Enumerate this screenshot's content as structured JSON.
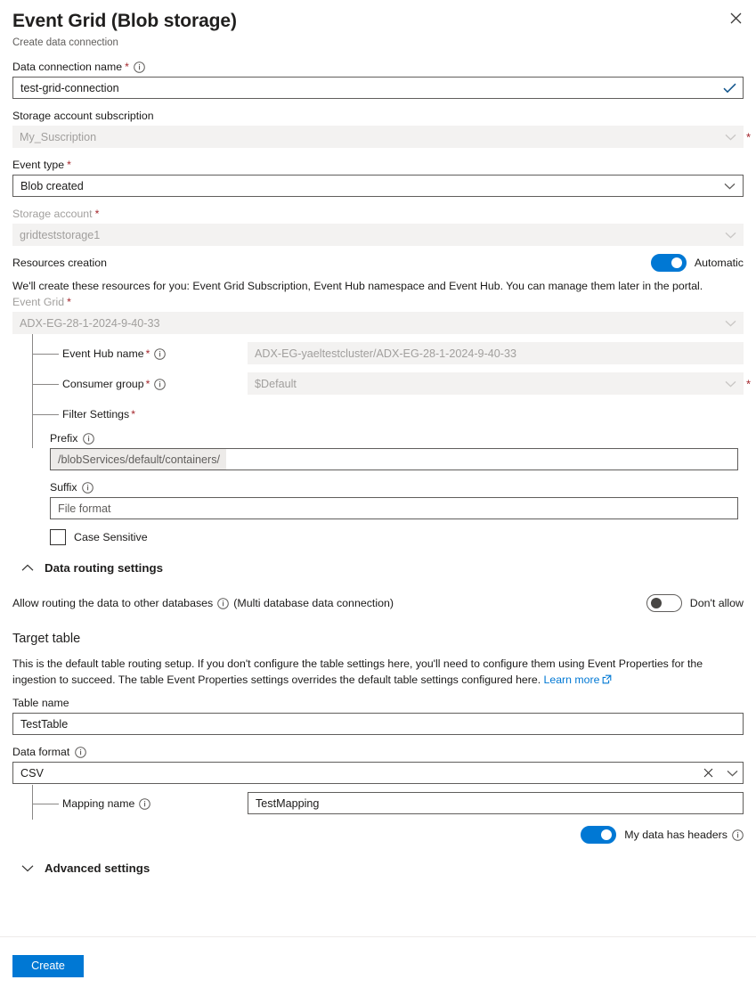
{
  "header": {
    "title": "Event Grid (Blob storage)",
    "subtitle": "Create data connection",
    "close_icon": "close-icon"
  },
  "colors": {
    "accent": "#0078d4",
    "required_asterisk": "#a4262c",
    "link": "#0078d4",
    "disabled_bg": "#f3f2f1",
    "disabled_text": "#a19f9d",
    "border": "#605e5c"
  },
  "form": {
    "data_connection_name": {
      "label": "Data connection name",
      "required": true,
      "info_icon": "info-icon",
      "value": "test-grid-connection",
      "validation_icon": "checkmark-icon"
    },
    "storage_account_subscription": {
      "label": "Storage account subscription",
      "required": false,
      "value": "My_Suscription",
      "disabled": true,
      "external_required_marker": "*",
      "chevron_icon": "chevron-down-icon"
    },
    "event_type": {
      "label": "Event type",
      "required": true,
      "value": "Blob created",
      "disabled": false,
      "chevron_icon": "chevron-down-icon"
    },
    "storage_account": {
      "label": "Storage account",
      "required": true,
      "value": "gridteststorage1",
      "disabled": true,
      "chevron_icon": "chevron-down-icon"
    },
    "resources_creation": {
      "label": "Resources creation",
      "toggle_state": "on",
      "toggle_label": "Automatic",
      "note": "We'll create these resources for you: Event Grid Subscription, Event Hub namespace and Event Hub. You can manage them later in the portal."
    },
    "event_grid": {
      "label": "Event Grid",
      "required": true,
      "value": "ADX-EG-28-1-2024-9-40-33",
      "disabled": true,
      "chevron_icon": "chevron-down-icon"
    },
    "event_hub_name": {
      "label": "Event Hub name",
      "required": true,
      "info_icon": "info-icon",
      "value": "ADX-EG-yaeltestcluster/ADX-EG-28-1-2024-9-40-33",
      "disabled": true
    },
    "consumer_group": {
      "label": "Consumer group",
      "required": true,
      "info_icon": "info-icon",
      "value": "$Default",
      "disabled": true,
      "external_required_marker": "*",
      "chevron_icon": "chevron-down-icon"
    },
    "filter_settings": {
      "label": "Filter Settings",
      "required": true,
      "prefix": {
        "label": "Prefix",
        "info_icon": "info-icon",
        "fixed_prefix": "/blobServices/default/containers/",
        "value": ""
      },
      "suffix": {
        "label": "Suffix",
        "info_icon": "info-icon",
        "placeholder": "File format",
        "value": ""
      },
      "case_sensitive": {
        "label": "Case Sensitive",
        "checked": false
      }
    }
  },
  "data_routing": {
    "section_title": "Data routing settings",
    "chevron_icon": "chevron-up-icon",
    "expanded": true,
    "allow_routing": {
      "label": "Allow routing the data to other databases",
      "info_icon": "info-icon",
      "suffix_text": "(Multi database data connection)",
      "toggle_state": "off",
      "toggle_label": "Don't allow"
    },
    "target_table": {
      "title": "Target table",
      "description_part1": "This is the default table routing setup. If you don't configure the table settings here, you'll need to configure them using Event Properties for the ingestion to succeed. The table Event Properties settings overrides the default table settings configured here. ",
      "learn_more": "Learn more",
      "learn_more_icon": "external-link-icon",
      "table_name": {
        "label": "Table name",
        "value": "TestTable"
      },
      "data_format": {
        "label": "Data format",
        "info_icon": "info-icon",
        "value": "CSV",
        "clear_icon": "close-icon",
        "chevron_icon": "chevron-down-icon"
      },
      "mapping_name": {
        "label": "Mapping name",
        "info_icon": "info-icon",
        "value": "TestMapping"
      },
      "headers_toggle": {
        "toggle_state": "on",
        "label": "My data has headers",
        "info_icon": "info-icon"
      }
    }
  },
  "advanced": {
    "section_title": "Advanced settings",
    "chevron_icon": "chevron-down-icon",
    "expanded": false
  },
  "footer": {
    "create_label": "Create"
  }
}
